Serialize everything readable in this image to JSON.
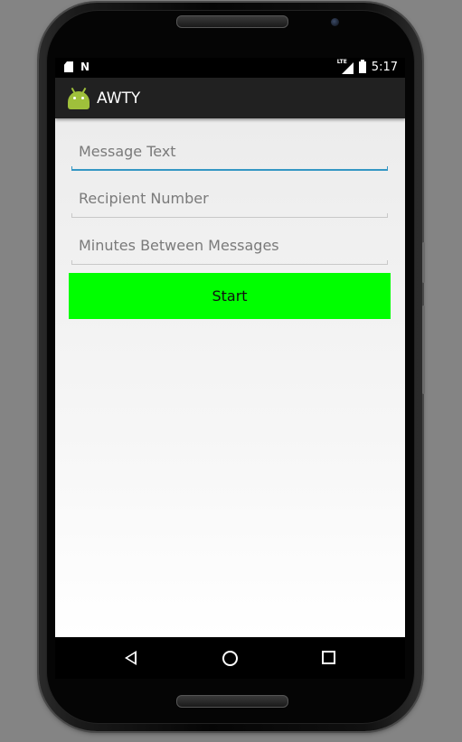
{
  "status_bar": {
    "time": "5:17",
    "network_label": "LTE",
    "icons": [
      "sd-card-icon",
      "n-notification-icon",
      "signal-icon",
      "battery-icon"
    ]
  },
  "app_bar": {
    "title": "AWTY",
    "icon": "android-app-icon",
    "background": "#212121"
  },
  "form": {
    "message_text": {
      "placeholder": "Message Text",
      "value": ""
    },
    "recipient_number": {
      "placeholder": "Recipient Number",
      "value": ""
    },
    "minutes_between": {
      "placeholder": "Minutes Between Messages",
      "value": ""
    },
    "start_label": "Start",
    "start_color": "#00ff00",
    "focus_color": "#3597c4"
  },
  "nav_bar": {
    "icons": [
      "back-icon",
      "home-icon",
      "recents-icon"
    ]
  }
}
